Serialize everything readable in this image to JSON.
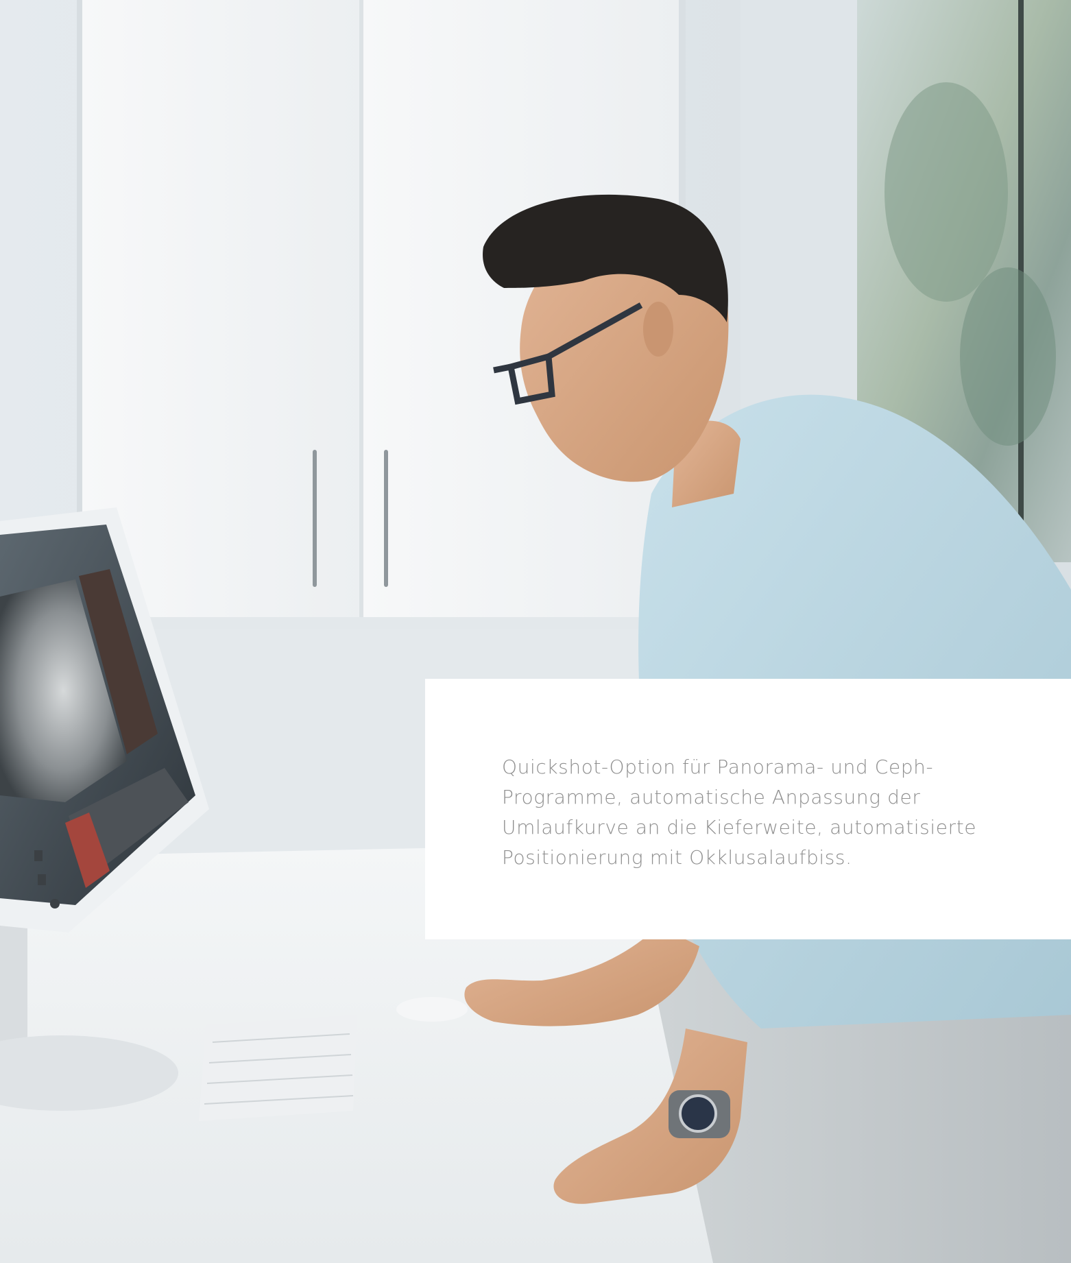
{
  "caption": {
    "lines": [
      "Quickshot-Option für Panorama- und Ceph-",
      "Programme, automatische Anpassung der",
      "Umlaufkurve an die Kieferweite, automatisierte",
      "Positionierung mit Okklusalaufbiss."
    ]
  },
  "colors": {
    "caption_text": "#8e8e8e",
    "panel_background": "#ffffff",
    "shirt": "#bcd7e2",
    "cabinet": "#f3f5f6"
  }
}
